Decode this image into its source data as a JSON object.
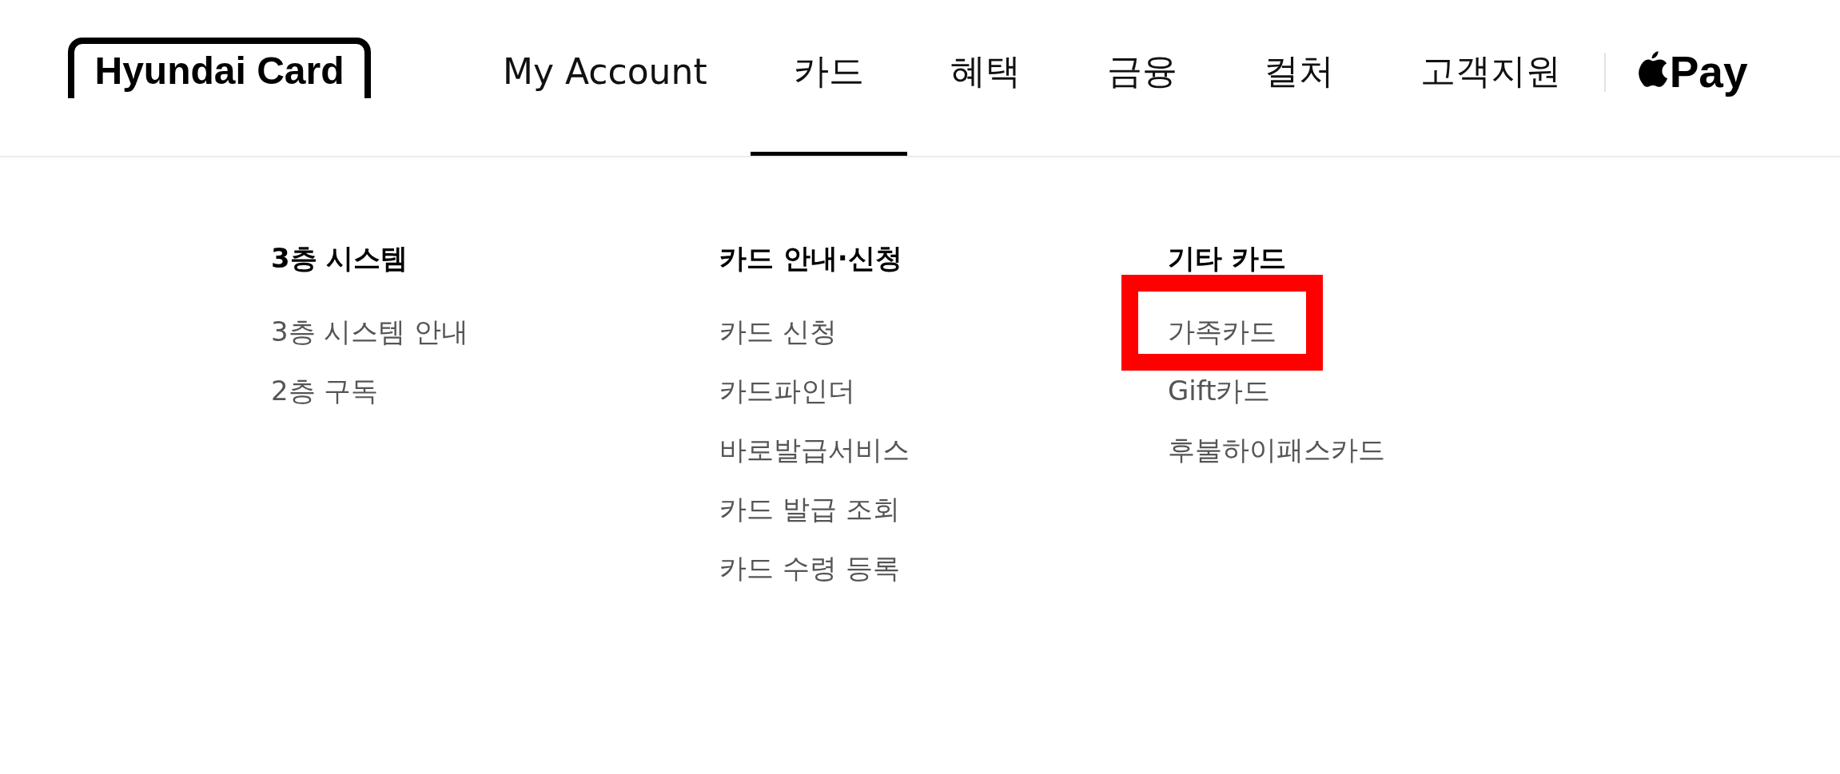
{
  "header": {
    "logo": "Hyundai Card",
    "nav": [
      {
        "label": "My Account",
        "selected": false
      },
      {
        "label": "카드",
        "selected": true
      },
      {
        "label": "혜택",
        "selected": false
      },
      {
        "label": "금융",
        "selected": false
      },
      {
        "label": "컬처",
        "selected": false
      },
      {
        "label": "고객지원",
        "selected": false
      }
    ],
    "pay_label": "Pay"
  },
  "menu": {
    "columns": [
      {
        "heading": "3층 시스템",
        "items": [
          {
            "label": "3층 시스템 안내",
            "highlighted": false
          },
          {
            "label": "2층 구독",
            "highlighted": false
          }
        ]
      },
      {
        "heading": "카드 안내·신청",
        "items": [
          {
            "label": "카드 신청",
            "highlighted": false
          },
          {
            "label": "카드파인더",
            "highlighted": false
          },
          {
            "label": "바로발급서비스",
            "highlighted": false
          },
          {
            "label": "카드 발급 조회",
            "highlighted": false
          },
          {
            "label": "카드 수령 등록",
            "highlighted": false
          }
        ]
      },
      {
        "heading": "기타 카드",
        "items": [
          {
            "label": "가족카드",
            "highlighted": true
          },
          {
            "label": "Gift카드",
            "highlighted": false
          },
          {
            "label": "후불하이패스카드",
            "highlighted": false
          }
        ]
      }
    ]
  }
}
